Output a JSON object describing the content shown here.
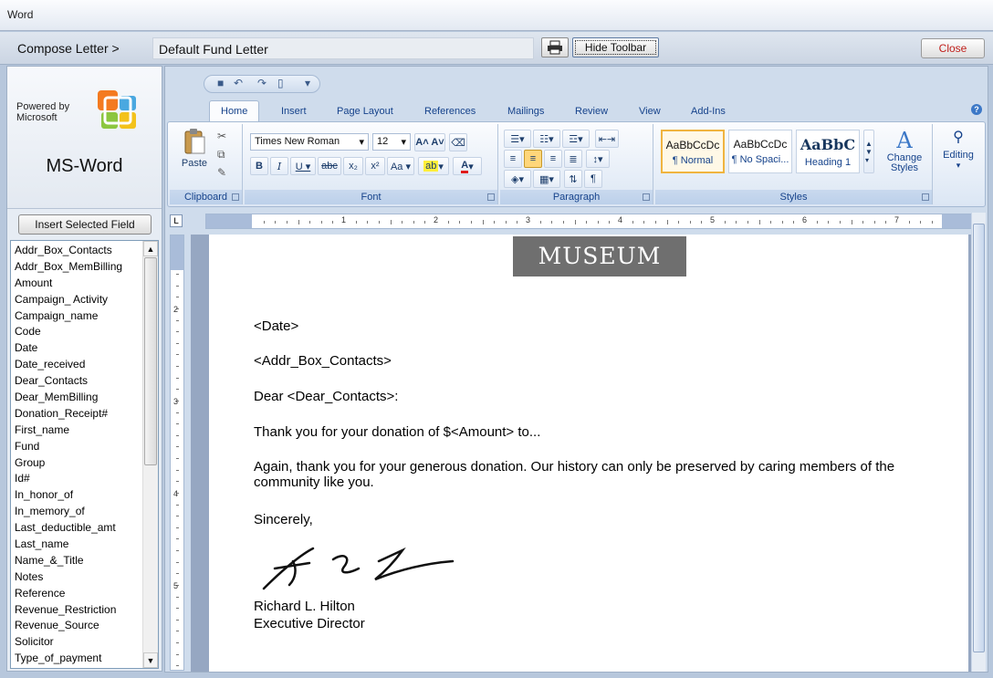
{
  "window": {
    "title": "Word"
  },
  "compose": {
    "label": "Compose Letter >",
    "document_name": "Default Fund Letter",
    "hide_toolbar_label": "Hide Toolbar",
    "close_label": "Close"
  },
  "sidebar": {
    "powered_by": "Powered by Microsoft",
    "app_name": "MS-Word",
    "insert_button": "Insert Selected Field",
    "fields": [
      "Addr_Box_Contacts",
      "Addr_Box_MemBilling",
      "Amount",
      "Campaign_ Activity",
      "Campaign_name",
      "Code",
      "Date",
      "Date_received",
      "Dear_Contacts",
      "Dear_MemBilling",
      "Donation_Receipt#",
      "First_name",
      "Fund",
      "Group",
      "Id#",
      "In_honor_of",
      "In_memory_of",
      "Last_deductible_amt",
      "Last_name",
      "Name_&_Title",
      "Notes",
      "Reference",
      "Revenue_Restriction",
      "Revenue_Source",
      "Solicitor",
      "Type_of_payment"
    ]
  },
  "ribbon": {
    "tabs": [
      "Home",
      "Insert",
      "Page Layout",
      "References",
      "Mailings",
      "Review",
      "View",
      "Add-Ins"
    ],
    "active_tab": "Home",
    "groups": {
      "clipboard": "Clipboard",
      "font": "Font",
      "paragraph": "Paragraph",
      "styles": "Styles"
    },
    "paste_label": "Paste",
    "font_name": "Times New Roman",
    "font_size": "12",
    "styles": [
      {
        "sample": "AaBbCcDc",
        "name": "¶ Normal"
      },
      {
        "sample": "AaBbCcDc",
        "name": "¶ No Spaci..."
      },
      {
        "sample": "AaBbC",
        "name": "Heading 1"
      }
    ],
    "change_styles_label": "Change Styles",
    "editing_label": "Editing",
    "ruler_numbers": [
      "1",
      "2",
      "3",
      "4",
      "5",
      "6",
      "7"
    ],
    "vruler_numbers": [
      "2",
      "3",
      "4",
      "5"
    ]
  },
  "letter": {
    "logo_text": "MUSEUM",
    "date": "<Date>",
    "address": "<Addr_Box_Contacts>",
    "salutation": "Dear <Dear_Contacts>:",
    "para1": "Thank you for your donation of $<Amount> to...",
    "para2": "Again, thank you for your generous donation.  Our history can only be preserved by caring members of the community like you.",
    "closing": "Sincerely,",
    "signer_name": "Richard L. Hilton",
    "signer_title": "Executive Director"
  },
  "colors": {
    "accent": "#15428b",
    "close_text": "#c0201c",
    "selected_style": "#f0b43f"
  }
}
